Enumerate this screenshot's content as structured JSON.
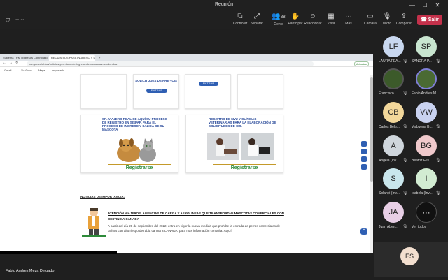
{
  "window": {
    "title": "Reunión",
    "controls": [
      "—",
      "☐",
      "✕"
    ]
  },
  "toolbar": {
    "items": [
      {
        "label": "Controlar",
        "icon": "⧉"
      },
      {
        "label": "Separar",
        "icon": "⤢"
      },
      {
        "label": "Gente",
        "icon": "👥",
        "count": "38"
      },
      {
        "label": "Participar",
        "icon": "✋"
      },
      {
        "label": "Reaccionar",
        "icon": "☺"
      },
      {
        "label": "Vista",
        "icon": "▦"
      },
      {
        "label": "Más",
        "icon": "···"
      },
      {
        "label": "Cámara",
        "icon": "▭"
      },
      {
        "label": "Micro",
        "icon": "🎙"
      },
      {
        "label": "Compartir",
        "icon": "⇪"
      }
    ],
    "leave_label": "Salir"
  },
  "browser": {
    "tabs": [
      "Sistema TPM / Egresos Controllado",
      "REQUISITOS PARA INGRESO Y SALIDA DE MASCOTAS",
      "+"
    ],
    "url": "Ica.gov.co/el-ica/noticias-permisos-de-ingreso-de-mascotas-a-colombia",
    "bookmarks": [
      "Gmail",
      "YouTube",
      "Maps",
      "Importado"
    ],
    "profile_chip": "Actualizar"
  },
  "page": {
    "top_cards": [
      {
        "title": "SOLICITUDES DE PRE - CIS",
        "button": "ENTRAR"
      },
      {
        "title": "",
        "button": "ENTRAR"
      }
    ],
    "promo_left": {
      "title": "SR. VIAJERO REALICE AQUÍ SU PROCESO DE REGISTRO EN SISPAP, PARA EL PROCESO DE INGRESO Y SALIDA DE SU MASCOTA",
      "button": "Registrarse"
    },
    "promo_right": {
      "title": "REGISTRO DE MVZ Y CLÍNICAS VETERINARIAS PARA LA ELABORACIÓN DE SOLICITUDES DE CIS.",
      "button": "Registrarse"
    },
    "news_header": "NOTICIAS DE IMPORTANCIA:",
    "news_title": "ATENCIÓN VIAJEROS, AGENCIAS DE CARGA Y AEROLINEAS QUE TRANSPORTAN MASCOTAS COMERCIALES CON DESTINO A CANADA",
    "news_body": "A partir del día 28 de septiembre del 2022, entra en vigor la nueva medida que prohíbe la entrada de perros comerciales de países con alto riesgo de rabia canina a CANADA, para más información consulta: AQUÍ"
  },
  "presenter_label": "Fabio Andres Meza Delgado",
  "participants": [
    {
      "initials": "LF",
      "name": "LAURA FEA...",
      "color": "#c9d8f0",
      "muted": true
    },
    {
      "initials": "SP",
      "name": "SANDRA P...",
      "color": "#c9e6d0",
      "muted": true
    },
    {
      "initials": "",
      "name": "Francisco L...",
      "color": "#3c5a2a",
      "muted": true,
      "photo": true
    },
    {
      "initials": "",
      "name": "Fabio Andres M...",
      "color": "#4a6a33",
      "muted": false,
      "photo": true
    },
    {
      "initials": "CB",
      "name": "Carlos Beltr...",
      "color": "#f2d79a",
      "muted": true
    },
    {
      "initials": "VW",
      "name": "Valbuena B...",
      "color": "#c9d2f0",
      "muted": true
    },
    {
      "initials": "A",
      "name": "Angela (Inv...",
      "color": "#cfd6dc",
      "muted": true
    },
    {
      "initials": "BG",
      "name": "Beatriz Elis...",
      "color": "#f0c9cc",
      "muted": true
    },
    {
      "initials": "S",
      "name": "Solanyi (Inv...",
      "color": "#c9e6ec",
      "muted": true
    },
    {
      "initials": "I",
      "name": "Isabela (Inv...",
      "color": "#d2ecd2",
      "muted": true
    },
    {
      "initials": "JA",
      "name": "Juan Aberr...",
      "color": "#e8cfe6",
      "muted": true
    },
    {
      "initials": "···",
      "name": "Ver todos",
      "color": "#111111",
      "muted": false
    }
  ],
  "self_view": {
    "initials": "ES"
  }
}
